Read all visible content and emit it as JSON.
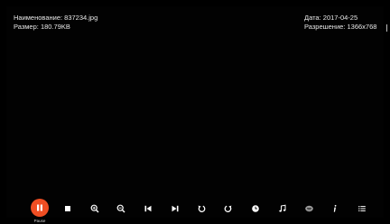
{
  "info": {
    "name_label": "Наименование: 837234.jpg",
    "size_label": "Размер: 180.79KB",
    "date_label": "Дата: 2017-04-25",
    "resolution_label": "Разрешение: 1366x768"
  },
  "toolbar": {
    "pause_label": "Pause",
    "accent_color": "#f04e23",
    "icons": [
      "pause-icon",
      "stop-icon",
      "zoom-in-icon",
      "zoom-out-icon",
      "previous-icon",
      "next-icon",
      "rotate-left-icon",
      "rotate-right-icon",
      "clock-icon",
      "music-note-icon",
      "subtitle-icon",
      "info-icon",
      "list-icon"
    ]
  }
}
